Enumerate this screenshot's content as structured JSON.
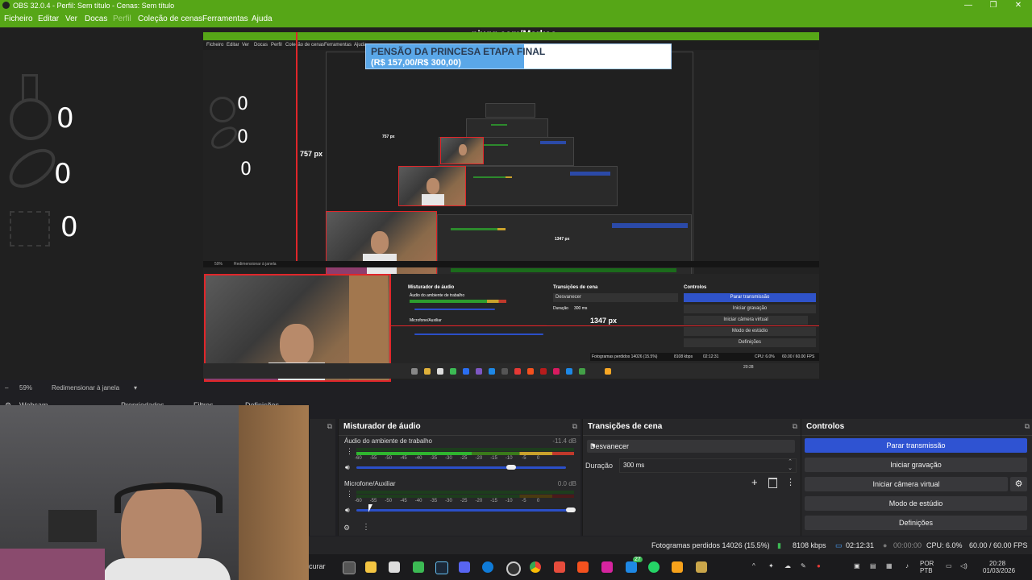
{
  "window": {
    "title": "OBS 32.0.4 - Perfil: Sem título - Cenas: Sem título",
    "controls": [
      "—",
      "❐",
      "✕"
    ]
  },
  "menu": {
    "items": [
      "Ficheiro",
      "Editar",
      "Ver",
      "Docas",
      "Perfil",
      "Coleção de cenas",
      "Ferramentas",
      "Ajuda"
    ]
  },
  "overlay": {
    "counters": [
      "0",
      "0",
      "0"
    ],
    "site": "pixgg.com/Markao",
    "banner_line1": "PENSÃO DA PRINCESA ETAPA FINAL",
    "banner_line2": "(R$ 157,00/R$ 300,00)",
    "nested_counters": [
      "0",
      "0",
      "0"
    ],
    "deep_counters": [
      "0",
      "0",
      "0"
    ],
    "height_label": "757 px",
    "width_label": "1347 px"
  },
  "preview_status": {
    "zoom": "59%",
    "resize_label": "Redimensionar à janela"
  },
  "source_tabs": {
    "webcam": "Webcam",
    "properties": "Propriedades",
    "filters": "Filtros",
    "settings": "Definições"
  },
  "mixer": {
    "title": "Misturador de áudio",
    "channels": [
      {
        "name": "Áudio do ambiente de trabalho",
        "db": "-11.4 dB",
        "level": 0.63,
        "volume": 0.74
      },
      {
        "name": "Microfone/Auxiliar",
        "db": "0.0 dB",
        "level": 0.0,
        "volume": 1.0
      }
    ],
    "ticks": [
      "-60",
      "-55",
      "-50",
      "-45",
      "-40",
      "-35",
      "-30",
      "-25",
      "-20",
      "-15",
      "-10",
      "-5",
      "0"
    ]
  },
  "transitions": {
    "title": "Transições de cena",
    "selected": "Desvanecer",
    "duration_label": "Duração",
    "duration_value": "300 ms"
  },
  "controls": {
    "title": "Controlos",
    "stop_stream": "Parar transmissão",
    "start_record": "Iniciar gravação",
    "start_virtualcam": "Iniciar câmera virtual",
    "studio_mode": "Modo de estúdio",
    "settings": "Definições"
  },
  "statusbar": {
    "dropped_frames": "Fotogramas perdidos 14026 (15.5%)",
    "bitrate": "8108 kbps",
    "stream_time": "02:12:31",
    "record_time": "00:00:00",
    "cpu": "CPU: 6.0%",
    "fps": "60.00 / 60.00 FPS"
  },
  "taskbar": {
    "search_fragment": "curar",
    "lang_line1": "POR",
    "lang_line2": "PTB",
    "time": "20:28",
    "date": "01/03/2026",
    "badge": "27"
  },
  "colors": {
    "obs_green": "#56a617",
    "accent_blue": "#2f53d2",
    "selection_red": "#e0262a"
  }
}
